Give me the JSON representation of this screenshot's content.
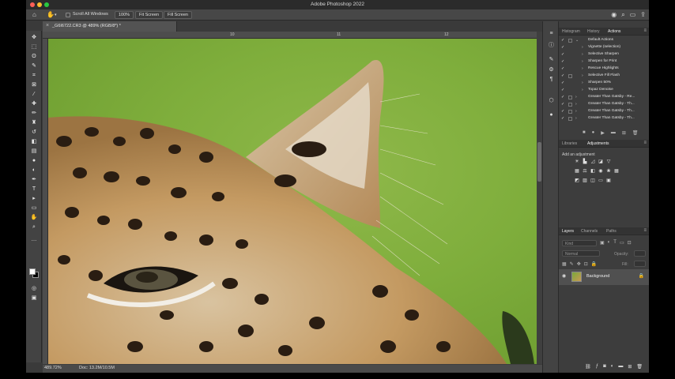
{
  "app": {
    "title": "Adobe Photoshop 2022",
    "traffic_colors": [
      "#fe5f57",
      "#febc2e",
      "#28c840"
    ]
  },
  "options_bar": {
    "scroll_all_windows": "Scroll All Windows",
    "zoom_btn": "100%",
    "fit_btn": "Fit Screen",
    "fill_btn": "Fill Screen"
  },
  "document": {
    "tab_name": "_G6I6722.CR3 @ 489% (RGB/8*) *",
    "ruler_top": [
      "10",
      "11",
      "12"
    ],
    "accent_ear": "#e0d2b8"
  },
  "status": {
    "zoom": "489.72%",
    "doc": "Doc: 13.2M/10.5M"
  },
  "actions_panel": {
    "tabs": [
      "Histogram",
      "History",
      "Actions"
    ],
    "items": [
      {
        "label": "Default Actions",
        "folder": true
      },
      {
        "label": "Vignette (selection)",
        "folder": false
      },
      {
        "label": "Selective Sharpen",
        "folder": false
      },
      {
        "label": "Sharpen for Print",
        "folder": false
      },
      {
        "label": "Rescue Highlights",
        "folder": false
      },
      {
        "label": "Selective Fill Flash",
        "folder": false
      },
      {
        "label": "Sharpen 50%",
        "folder": false
      },
      {
        "label": "Topaz Denoise",
        "folder": false
      },
      {
        "label": "Greater Than Gatsby - Re...",
        "folder": true
      },
      {
        "label": "Greater Than Gatsby - Th...",
        "folder": true
      },
      {
        "label": "Greater Than Gatsby - Th...",
        "folder": true
      },
      {
        "label": "Greater Than Gatsby - Th...",
        "folder": true
      }
    ]
  },
  "adjustments_panel": {
    "tabs": [
      "Libraries",
      "Adjustments"
    ],
    "add_label": "Add an adjustment"
  },
  "layers_panel": {
    "tabs": [
      "Layers",
      "Channels",
      "Paths"
    ],
    "kind_placeholder": "Kind",
    "blend_mode": "Normal",
    "opacity_label": "Opacity:",
    "fill_label": "Fill:",
    "layers": [
      {
        "name": "Background",
        "locked": true
      }
    ]
  }
}
